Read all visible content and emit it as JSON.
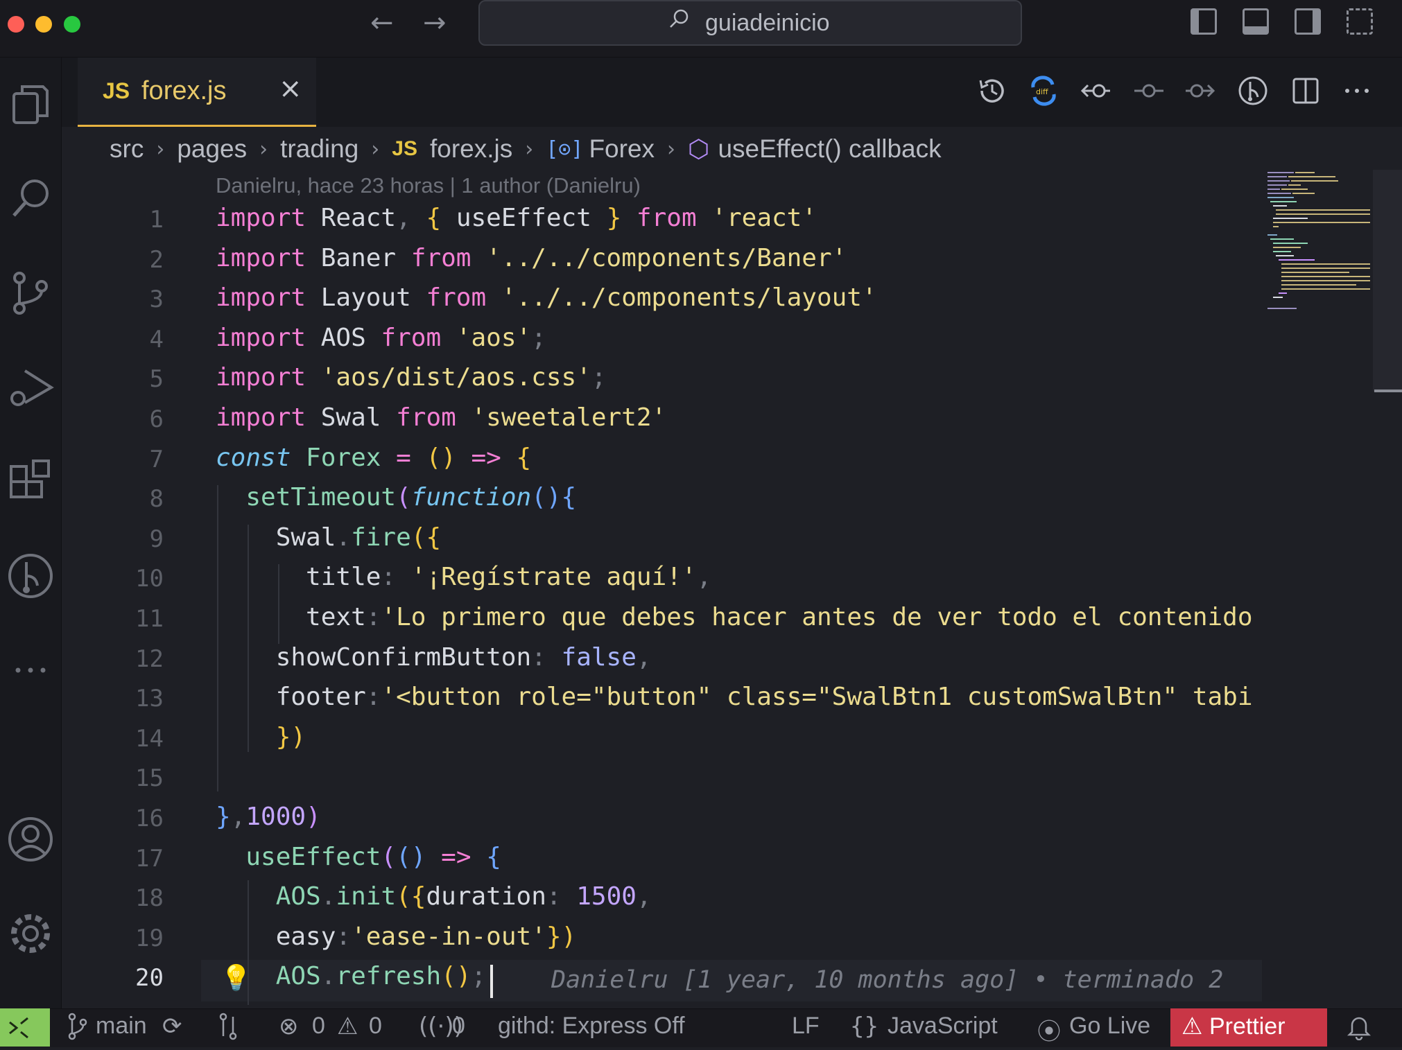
{
  "colors": {
    "accent": "#e7b341",
    "prettier_bg": "#c93646",
    "remote_bg": "#86c85c"
  },
  "titlebar": {
    "search_text": "guiadeinicio"
  },
  "activity_bar": {
    "icons": [
      "explorer-icon",
      "search-icon",
      "source-control-icon",
      "run-debug-icon",
      "extensions-icon",
      "git-graph-icon",
      "more-icon",
      "account-icon",
      "settings-gear-icon"
    ]
  },
  "tab": {
    "badge": "JS",
    "name": "forex.js",
    "close": "×"
  },
  "breadcrumb": {
    "items": [
      "src",
      "pages",
      "trading"
    ],
    "file_badge": "JS",
    "file": "forex.js",
    "symbol_icon": "[⊙]",
    "symbol": "Forex",
    "callback": "useEffect() callback",
    "separator": "›"
  },
  "blame_header": "Danielru, hace 23 horas | 1 author (Danielru)",
  "code": {
    "line_numbers": [
      "1",
      "2",
      "3",
      "4",
      "5",
      "6",
      "7",
      "8",
      "9",
      "10",
      "11",
      "12",
      "13",
      "14",
      "15",
      "16",
      "17",
      "18",
      "19",
      "20"
    ],
    "lines": [
      [
        [
          "k",
          "import"
        ],
        [
          "v",
          " React"
        ],
        [
          "p",
          ", "
        ],
        [
          "y",
          "{ "
        ],
        [
          "v",
          "useEffect "
        ],
        [
          "y",
          "}"
        ],
        [
          "k",
          " from "
        ],
        [
          "s",
          "'react'"
        ]
      ],
      [
        [
          "k",
          "import"
        ],
        [
          "v",
          " Baner "
        ],
        [
          "k",
          "from "
        ],
        [
          "s",
          "'../../components/Baner'"
        ]
      ],
      [
        [
          "k",
          "import"
        ],
        [
          "v",
          " Layout "
        ],
        [
          "k",
          "from "
        ],
        [
          "s",
          "'../../components/layout'"
        ]
      ],
      [
        [
          "k",
          "import"
        ],
        [
          "v",
          " AOS "
        ],
        [
          "k",
          "from "
        ],
        [
          "s",
          "'aos'"
        ],
        [
          "p",
          ";"
        ]
      ],
      [
        [
          "k",
          "import "
        ],
        [
          "s",
          "'aos/dist/aos.css'"
        ],
        [
          "p",
          ";"
        ]
      ],
      [
        [
          "k",
          "import"
        ],
        [
          "v",
          " Swal "
        ],
        [
          "k",
          "from "
        ],
        [
          "s",
          "'sweetalert2'"
        ]
      ],
      [
        [
          "c it",
          "const"
        ],
        [
          "fn",
          " Forex "
        ],
        [
          "k",
          "= "
        ],
        [
          "y",
          "() "
        ],
        [
          "k",
          "=> "
        ],
        [
          "y",
          "{"
        ]
      ],
      [
        [
          "v",
          "  "
        ],
        [
          "fn",
          "setTimeout"
        ],
        [
          "pu",
          "("
        ],
        [
          "c it",
          "function"
        ],
        [
          "bl",
          "(){"
        ]
      ],
      [
        [
          "v",
          "    Swal"
        ],
        [
          "p",
          "."
        ],
        [
          "fn",
          "fire"
        ],
        [
          "y",
          "({"
        ]
      ],
      [
        [
          "v",
          "      title"
        ],
        [
          "p",
          ": "
        ],
        [
          "s",
          "'¡Regístrate aquí!'"
        ],
        [
          "p",
          ","
        ]
      ],
      [
        [
          "v",
          "      text"
        ],
        [
          "p",
          ":"
        ],
        [
          "s",
          "'Lo primero que debes hacer antes de ver todo el contenido"
        ]
      ],
      [
        [
          "v",
          "    showConfirmButton"
        ],
        [
          "p",
          ": "
        ],
        [
          "kw2",
          "false"
        ],
        [
          "p",
          ","
        ]
      ],
      [
        [
          "v",
          "    footer"
        ],
        [
          "p",
          ":"
        ],
        [
          "s",
          "'<button role=\"button\" class=\"SwalBtn1 customSwalBtn\" tabi"
        ]
      ],
      [
        [
          "v",
          "    "
        ],
        [
          "y",
          "})"
        ]
      ],
      [
        [
          "v",
          ""
        ]
      ],
      [
        [
          "bl",
          "}"
        ],
        [
          "p",
          ","
        ],
        [
          "num",
          "1000"
        ],
        [
          "pu",
          ")"
        ]
      ],
      [
        [
          "v",
          "  "
        ],
        [
          "fn",
          "useEffect"
        ],
        [
          "pu",
          "("
        ],
        [
          "bl",
          "()"
        ],
        [
          "k",
          " => "
        ],
        [
          "bl",
          "{"
        ]
      ],
      [
        [
          "v",
          "    "
        ],
        [
          "fn",
          "AOS"
        ],
        [
          "p",
          "."
        ],
        [
          "fn",
          "init"
        ],
        [
          "y",
          "({"
        ],
        [
          "v",
          "duration"
        ],
        [
          "p",
          ": "
        ],
        [
          "num",
          "1500"
        ],
        [
          "p",
          ","
        ]
      ],
      [
        [
          "v",
          "    easy"
        ],
        [
          "p",
          ":"
        ],
        [
          "s",
          "'ease-in-out'"
        ],
        [
          "y",
          "})"
        ]
      ],
      [
        [
          "v",
          "    "
        ],
        [
          "fn",
          "AOS"
        ],
        [
          "p",
          "."
        ],
        [
          "fn",
          "refresh"
        ],
        [
          "y",
          "()"
        ],
        [
          "p",
          ";"
        ]
      ]
    ]
  },
  "inline_blame": "Danielru [1 year, 10 months ago] • terminado 2",
  "statusbar": {
    "branch": "main",
    "errors": "0",
    "warnings": "0",
    "ports": "0",
    "githd": "githd: Express Off",
    "eol": "LF",
    "language": "JavaScript",
    "golive": "Go Live",
    "prettier": "Prettier"
  }
}
